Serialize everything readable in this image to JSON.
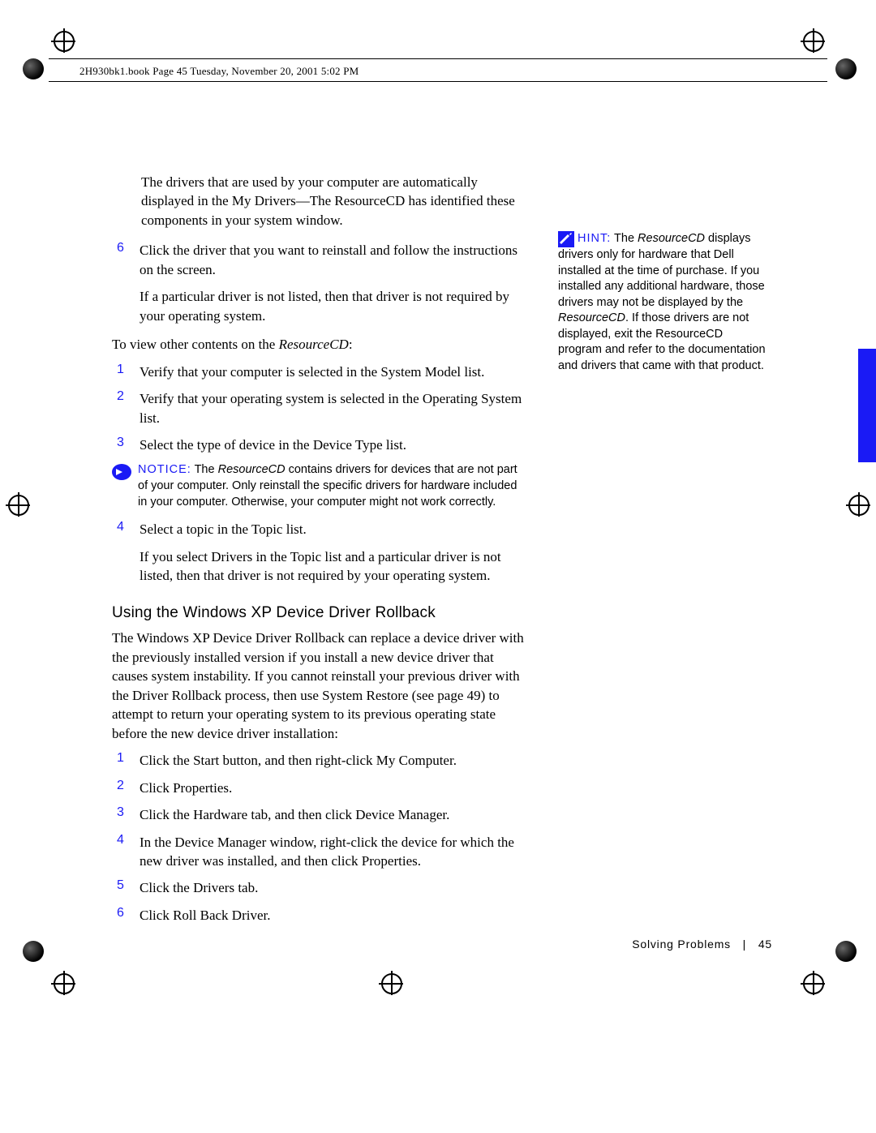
{
  "header": "2H930bk1.book  Page 45  Tuesday, November 20, 2001  5:02 PM",
  "intro": "The drivers that are used by your computer are automatically displayed in the My Drivers—The ResourceCD has identified these components in your system window.",
  "step6_num": "6",
  "step6_text": "Click the driver that you want to reinstall and follow the instructions on the screen.",
  "step6_note": "If a particular driver is not listed, then that driver is not required by your operating system.",
  "view_intro_a": "To view other contents on the ",
  "view_intro_b": "ResourceCD",
  "view_intro_c": ":",
  "v1_num": "1",
  "v1": "Verify that your computer is selected in the System Model list.",
  "v2_num": "2",
  "v2": "Verify that your operating system is selected in the Operating System list.",
  "v3_num": "3",
  "v3": "Select the type of device in the Device Type list.",
  "notice_label": "NOTICE:",
  "notice_a": " The ",
  "notice_b": "ResourceCD",
  "notice_c": " contains drivers for devices that are not part of your computer. Only reinstall the specific drivers for hardware included in your computer. Otherwise, your computer might not work correctly.",
  "v4_num": "4",
  "v4": "Select a topic in the Topic list.",
  "v4_note": "If you select Drivers in the Topic list and a particular driver is not listed, then that driver is not required by your operating system.",
  "section_title": "Using the Windows XP Device Driver Rollback",
  "section_para": "The Windows XP Device Driver Rollback can replace a device driver with the previously installed version if you install a new device driver that causes system instability. If you cannot reinstall your previous driver with the Driver Rollback process, then use System Restore (see page 49) to attempt to return your operating system to its previous operating state before the new device driver installation:",
  "r1_num": "1",
  "r1": "Click the Start button, and then right-click My Computer.",
  "r2_num": "2",
  "r2": "Click Properties.",
  "r3_num": "3",
  "r3": "Click the Hardware tab, and then click Device Manager.",
  "r4_num": "4",
  "r4": "In the Device Manager window, right-click the device for which the new driver was installed, and then click Properties.",
  "r5_num": "5",
  "r5": "Click the Drivers tab.",
  "r6_num": "6",
  "r6": "Click Roll Back Driver.",
  "hint_label": "HINT:",
  "hint_a": " The ",
  "hint_b": "ResourceCD",
  "hint_c": " displays drivers only for hardware that Dell installed at the time of purchase. If you installed any additional hardware, those drivers may not be displayed by the ",
  "hint_d": "ResourceCD",
  "hint_e": ". If those drivers are not displayed, exit the ResourceCD program and refer to the documentation and drivers that came with that product.",
  "footer_section": "Solving Problems",
  "footer_page": "45"
}
